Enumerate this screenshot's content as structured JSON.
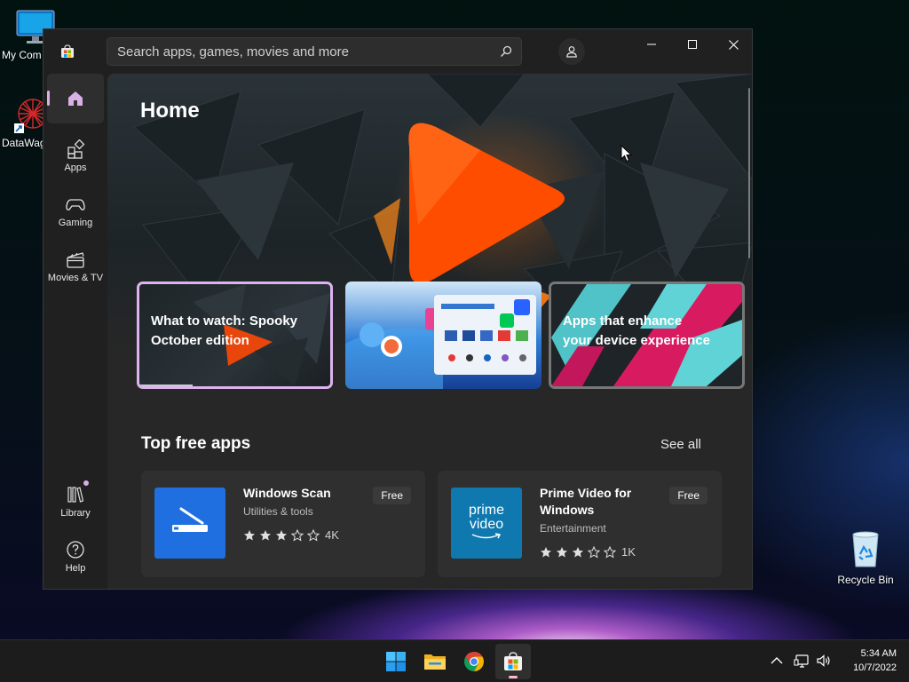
{
  "desktop": {
    "icons": [
      {
        "label": "My Com"
      },
      {
        "label": "DataWag"
      },
      {
        "label": "Recycle Bin"
      }
    ]
  },
  "window": {
    "search": {
      "placeholder": "Search apps, games, movies and more"
    },
    "controls": [
      "minimize",
      "maximize",
      "close"
    ]
  },
  "sidebar": {
    "items": [
      {
        "label": "",
        "icon": "home-icon",
        "active": true
      },
      {
        "label": "Apps",
        "icon": "apps-icon"
      },
      {
        "label": "Gaming",
        "icon": "gamepad-icon"
      },
      {
        "label": "Movies & TV",
        "icon": "clapperboard-icon"
      },
      {
        "label": "Library",
        "icon": "library-icon"
      },
      {
        "label": "Help",
        "icon": "help-icon"
      }
    ]
  },
  "hero": {
    "title": "Home"
  },
  "promos": [
    {
      "text": "What to watch: Spooky October edition"
    },
    {
      "text": ""
    },
    {
      "text": "Apps that enhance your device experience"
    }
  ],
  "section": {
    "title": "Top free apps",
    "see_all": "See all"
  },
  "apps": [
    {
      "name": "Windows Scan",
      "category": "Utilities & tools",
      "rating": 3,
      "rating_count": "4K",
      "price": "Free",
      "icon_color": "#1f6fe0"
    },
    {
      "name": "Prime Video for Windows",
      "category": "Entertainment",
      "rating": 3,
      "rating_count": "1K",
      "price": "Free",
      "icon_color": "#0f79af",
      "icon_text_1": "prime",
      "icon_text_2": "video"
    }
  ],
  "taskbar": {
    "apps": [
      "windows-start-icon",
      "file-explorer-icon",
      "chrome-icon",
      "microsoft-store-icon"
    ],
    "time": "5:34 AM",
    "date": "10/7/2022"
  },
  "colors": {
    "accent": "#d9b0e6",
    "window_bg": "#202020",
    "content_bg": "#272727",
    "card_bg": "#2f2f2f"
  }
}
